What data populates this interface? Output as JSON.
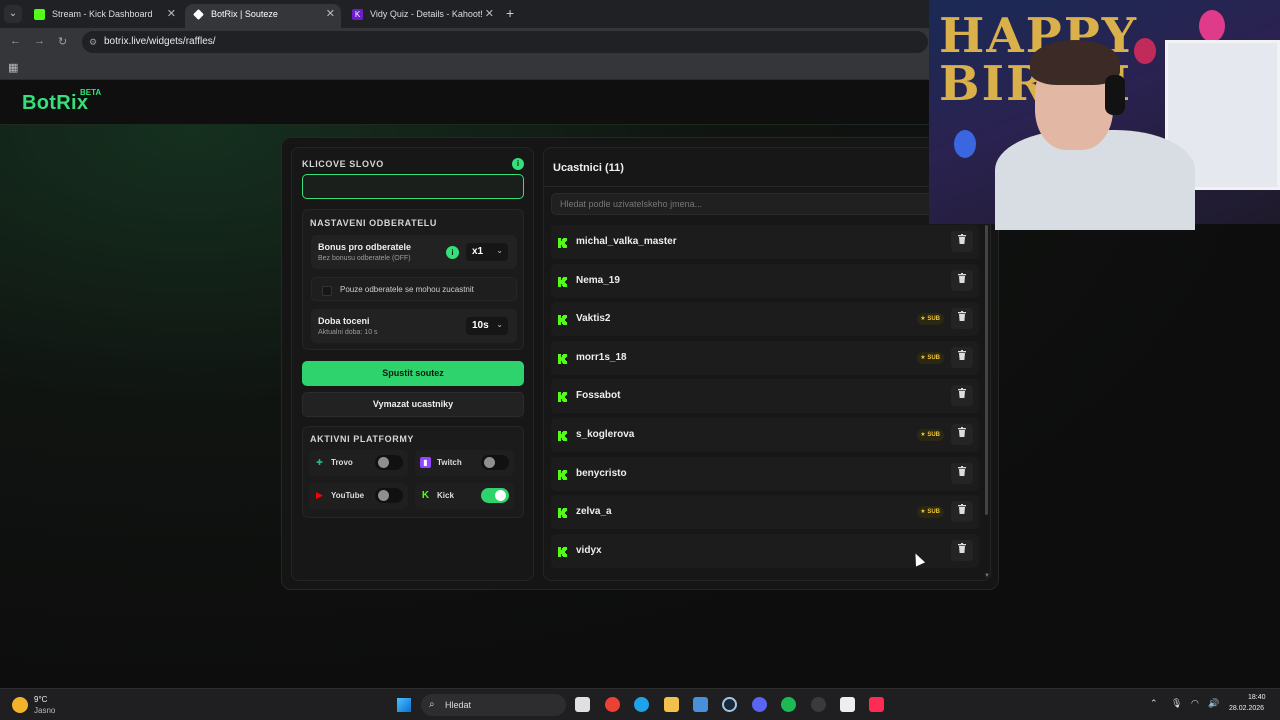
{
  "browser": {
    "tabs": [
      {
        "title": "Stream - Kick Dashboard",
        "favicon_color": "#53fc18"
      },
      {
        "title": "BotRix | Souteze",
        "favicon_color": "#ffffff"
      },
      {
        "title": "Vidy Quiz - Details - Kahoot!",
        "favicon_color": "#6c1fc9"
      }
    ],
    "url": "botrix.live/widgets/raffles/"
  },
  "site": {
    "logo": "BotRix",
    "logo_badge": "BETA",
    "accent": "#35e07a"
  },
  "keyword": {
    "label": "KLICOVE SLOVO",
    "info_icon": "info-icon",
    "value": ""
  },
  "subscriber_settings": {
    "title": "NASTAVENI ODBERATELU",
    "bonus_title": "Bonus pro odberatele",
    "bonus_subtitle": "Bez bonusu odberatele (OFF)",
    "bonus_value": "x1",
    "subs_only_label": "Pouze odberatele se mohou zucastnit",
    "subs_only_checked": false,
    "spin_title": "Doba toceni",
    "spin_subtitle": "Aktualni doba: 10 s",
    "spin_value": "10s"
  },
  "actions": {
    "start": "Spustit soutez",
    "clear": "Vymazat ucastniky"
  },
  "platforms": {
    "title": "AKTIVNI PLATFORMY",
    "items": [
      {
        "name": "Trovo",
        "enabled": false,
        "icon": "trovo-icon",
        "color": "#1cc27a"
      },
      {
        "name": "Twitch",
        "enabled": false,
        "icon": "twitch-icon",
        "color": "#9146ff"
      },
      {
        "name": "YouTube",
        "enabled": false,
        "icon": "youtube-icon",
        "color": "#ff0000"
      },
      {
        "name": "Kick",
        "enabled": true,
        "icon": "kick-icon",
        "color": "#53fc18"
      }
    ]
  },
  "participants": {
    "title": "Ucastnici (11)",
    "search_placeholder": "Hledat podle uzivatelskeho jmena...",
    "sub_badge": "SUB",
    "list": [
      {
        "name": "michal_valka_master",
        "sub": false
      },
      {
        "name": "Nema_19",
        "sub": false
      },
      {
        "name": "Vaktis2",
        "sub": true
      },
      {
        "name": "morr1s_18",
        "sub": true
      },
      {
        "name": "Fossabot",
        "sub": false
      },
      {
        "name": "s_koglerova",
        "sub": true
      },
      {
        "name": "benycristo",
        "sub": false
      },
      {
        "name": "zelva_a",
        "sub": true
      },
      {
        "name": "vidyx",
        "sub": false
      }
    ]
  },
  "webcam": {
    "banner": "HAPPY BIRTH"
  },
  "taskbar": {
    "temperature": "9°C",
    "weather": "Jasno",
    "search_label": "Hledat",
    "time": "18:40",
    "date": "28.02.2026"
  }
}
